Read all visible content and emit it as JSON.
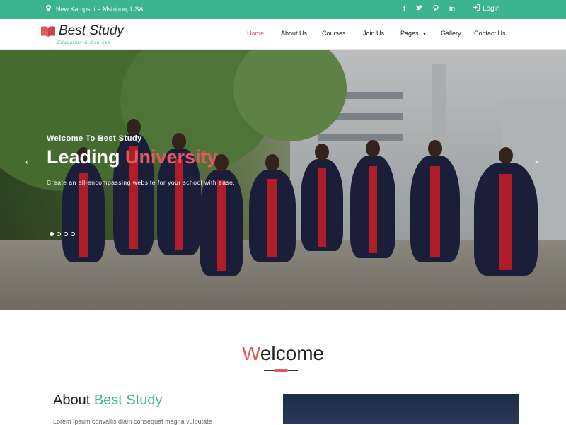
{
  "topbar": {
    "location_text": "New Kampshire Mshinon, USA",
    "socials": [
      "f",
      "t",
      "p",
      "in"
    ],
    "login_label": "Login"
  },
  "navbar": {
    "brand": "Best Study",
    "tagline": "Education & Courses",
    "menu": [
      "Home",
      "About Us",
      "Courses",
      "Join Us",
      "Pages",
      "Gallery",
      "Contact Us"
    ],
    "active_item": "Home"
  },
  "hero": {
    "kicker": "Welcome To Best Study",
    "headline_main": "Leading ",
    "headline_highlight": "University",
    "description": "Create an all-encompassing website for your school with ease.",
    "slides_count": 4,
    "active_slide": 1
  },
  "welcome": {
    "title_first_letter": "W",
    "title_rest": "elcome"
  },
  "about": {
    "title_main": "About ",
    "title_highlight": "Best Study",
    "text": "Lorem Ipsum convallis diam consequat magna vulputate"
  },
  "colors": {
    "accent_green": "#3cb58f",
    "accent_red": "#e05a5f"
  }
}
